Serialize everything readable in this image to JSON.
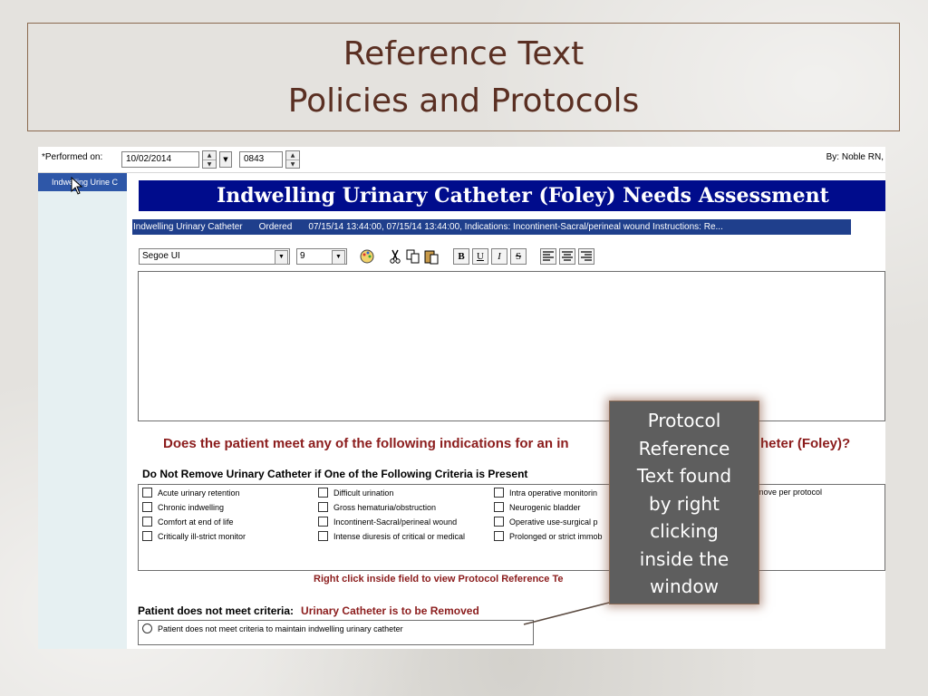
{
  "slide": {
    "title_line1": "Reference Text",
    "title_line2": "Policies and Protocols"
  },
  "header": {
    "performed_label": "*Performed on:",
    "date_value": "10/02/2014",
    "time_value": "0843",
    "by_label": "By:  Noble RN,"
  },
  "sidebar": {
    "items": [
      {
        "label": "Indwelling Urine C"
      }
    ]
  },
  "form": {
    "banner": "Indwelling Urinary Catheter (Foley) Needs Assessment",
    "order": {
      "name": "Indwelling Urinary Catheter",
      "status": "Ordered",
      "details": "07/15/14 13:44:00, 07/15/14 13:44:00, Indications: Incontinent-Sacral/perineal wound Instructions: Re..."
    },
    "toolbar": {
      "font": "Segoe UI",
      "size": "9",
      "bold": "B",
      "underline": "U",
      "italic": "I",
      "strike": "S"
    },
    "question": "Does the patient meet any of the following indications for an in",
    "question_end": "heter (Foley)?",
    "criteria_title": "Do Not Remove Urinary Catheter if One of the Following Criteria is Present",
    "criteria_col1": [
      "Acute urinary retention",
      "Chronic indwelling",
      "Comfort at end of life",
      "Critically ill-strict monitor"
    ],
    "criteria_col2": [
      "Difficult urination",
      "Gross hematuria/obstruction",
      "Incontinent-Sacral/perineal wound",
      "Intense diuresis of critical or medical"
    ],
    "criteria_col3": [
      "Intra operative monitorin",
      "Neurogenic bladder",
      "Operative use-surgical p",
      "Prolonged or strict immob"
    ],
    "criteria_col4_fragment": "move per protocol",
    "right_click_note": "Right click inside field to view Protocol Reference Te",
    "not_meet_label": "Patient does not meet criteria:",
    "not_meet_value": "Urinary Catheter is to be Removed",
    "radio_label": "Patient does not meet criteria to maintain indwelling urinary catheter"
  },
  "callout": {
    "lines": [
      "Protocol",
      "Reference",
      "Text found",
      "by right",
      "clicking",
      "inside the",
      "window"
    ]
  },
  "colors": {
    "banner_bg": "#000c8c",
    "question_red": "#8b1c1c",
    "sidebar_selected": "#2e57a8",
    "title_color": "#5a2f22"
  }
}
